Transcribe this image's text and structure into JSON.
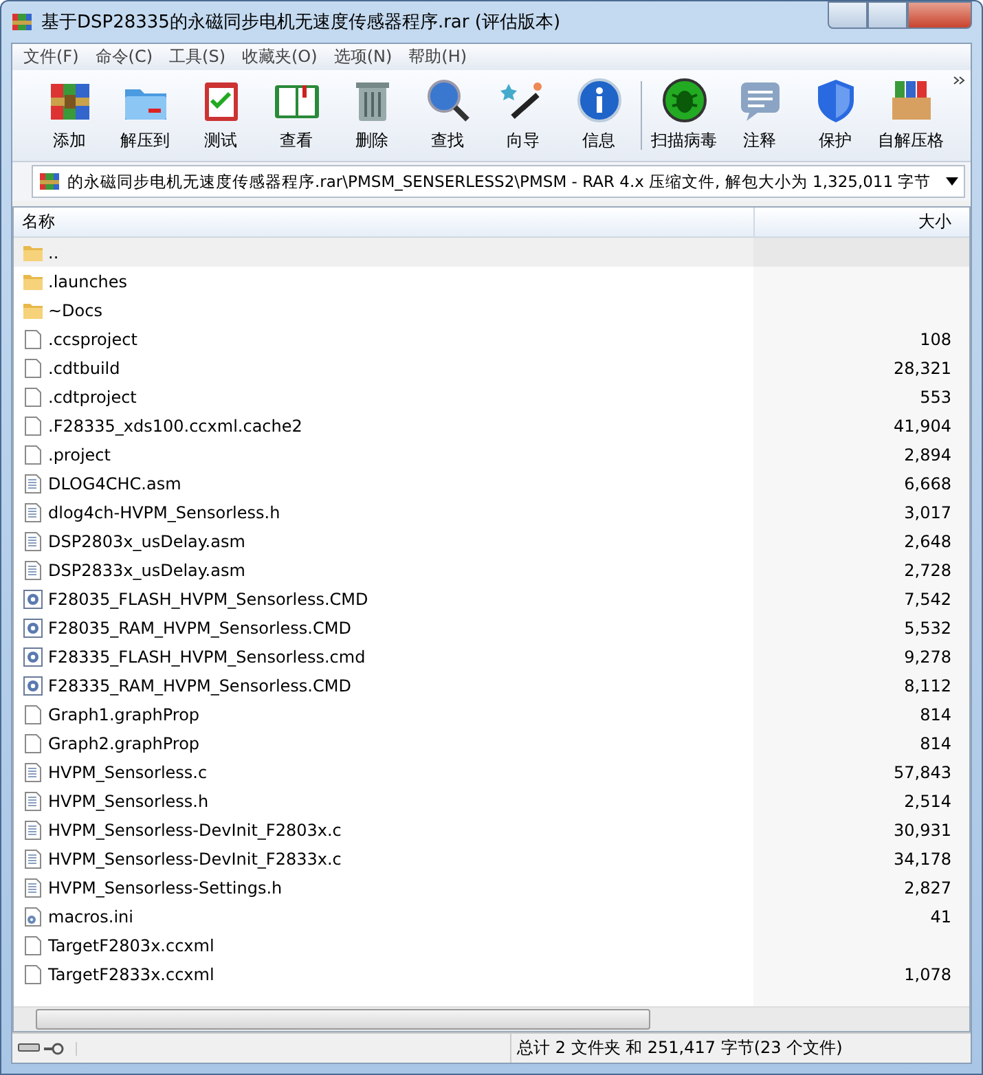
{
  "window": {
    "title": "基于DSP28335的永磁同步电机无速度传感器程序.rar (评估版本)"
  },
  "menu": [
    "文件(F)",
    "命令(C)",
    "工具(S)",
    "收藏夹(O)",
    "选项(N)",
    "帮助(H)"
  ],
  "toolbar": [
    {
      "kind": "add",
      "label": "添加"
    },
    {
      "kind": "extract",
      "label": "解压到"
    },
    {
      "kind": "test",
      "label": "测试"
    },
    {
      "kind": "view",
      "label": "查看"
    },
    {
      "kind": "delete",
      "label": "删除"
    },
    {
      "kind": "find",
      "label": "查找"
    },
    {
      "kind": "wizard",
      "label": "向导"
    },
    {
      "kind": "info",
      "label": "信息"
    },
    {
      "kind": "scan",
      "label": "扫描病毒"
    },
    {
      "kind": "comment",
      "label": "注释"
    },
    {
      "kind": "protect",
      "label": "保护"
    },
    {
      "kind": "sfx",
      "label": "自解压格"
    }
  ],
  "address": "的永磁同步电机无速度传感器程序.rar\\PMSM_SENSERLESS2\\PMSM - RAR 4.x 压缩文件, 解包大小为 1,325,011 字节",
  "table": {
    "columns": [
      "名称",
      "大小"
    ],
    "rows": [
      {
        "kind": "up",
        "name": "..",
        "selected": true
      },
      {
        "kind": "folder",
        "name": ".launches",
        "selected": false
      },
      {
        "kind": "folder",
        "name": "~Docs",
        "selected": false
      },
      {
        "kind": "blank",
        "name": ".ccsproject",
        "size": "108",
        "selected": false
      },
      {
        "kind": "blank",
        "name": ".cdtbuild",
        "size": "28,321",
        "selected": false
      },
      {
        "kind": "blank",
        "name": ".cdtproject",
        "size": "553",
        "selected": false
      },
      {
        "kind": "blank",
        "name": ".F28335_xds100.ccxml.cache2",
        "size": "41,904",
        "selected": false
      },
      {
        "kind": "blank",
        "name": ".project",
        "size": "2,894",
        "selected": false
      },
      {
        "kind": "text",
        "name": "DLOG4CHC.asm",
        "size": "6,668",
        "selected": false
      },
      {
        "kind": "text",
        "name": "dlog4ch-HVPM_Sensorless.h",
        "size": "3,017",
        "selected": false
      },
      {
        "kind": "text",
        "name": "DSP2803x_usDelay.asm",
        "size": "2,648",
        "selected": false
      },
      {
        "kind": "text",
        "name": "DSP2833x_usDelay.asm",
        "size": "2,728",
        "selected": false
      },
      {
        "kind": "batch",
        "name": "F28035_FLASH_HVPM_Sensorless.CMD",
        "size": "7,542",
        "selected": false
      },
      {
        "kind": "batch",
        "name": "F28035_RAM_HVPM_Sensorless.CMD",
        "size": "5,532",
        "selected": false
      },
      {
        "kind": "batch",
        "name": "F28335_FLASH_HVPM_Sensorless.cmd",
        "size": "9,278",
        "selected": false
      },
      {
        "kind": "batch",
        "name": "F28335_RAM_HVPM_Sensorless.CMD",
        "size": "8,112",
        "selected": false
      },
      {
        "kind": "blank",
        "name": "Graph1.graphProp",
        "size": "814",
        "selected": false
      },
      {
        "kind": "blank",
        "name": "Graph2.graphProp",
        "size": "814",
        "selected": false
      },
      {
        "kind": "text",
        "name": "HVPM_Sensorless.c",
        "size": "57,843",
        "selected": false
      },
      {
        "kind": "text",
        "name": "HVPM_Sensorless.h",
        "size": "2,514",
        "selected": false
      },
      {
        "kind": "text",
        "name": "HVPM_Sensorless-DevInit_F2803x.c",
        "size": "30,931",
        "selected": false
      },
      {
        "kind": "text",
        "name": "HVPM_Sensorless-DevInit_F2833x.c",
        "size": "34,178",
        "selected": false
      },
      {
        "kind": "text",
        "name": "HVPM_Sensorless-Settings.h",
        "size": "2,827",
        "selected": false
      },
      {
        "kind": "settings",
        "name": "macros.ini",
        "size": "41",
        "selected": false
      },
      {
        "kind": "blank",
        "name": "TargetF2803x.ccxml",
        "selected": false
      },
      {
        "kind": "blank",
        "name": "TargetF2833x.ccxml",
        "size": "1,078",
        "selected": false
      }
    ]
  },
  "status_bar": "总计 2 文件夹 和 251,417 字节(23 个文件)"
}
